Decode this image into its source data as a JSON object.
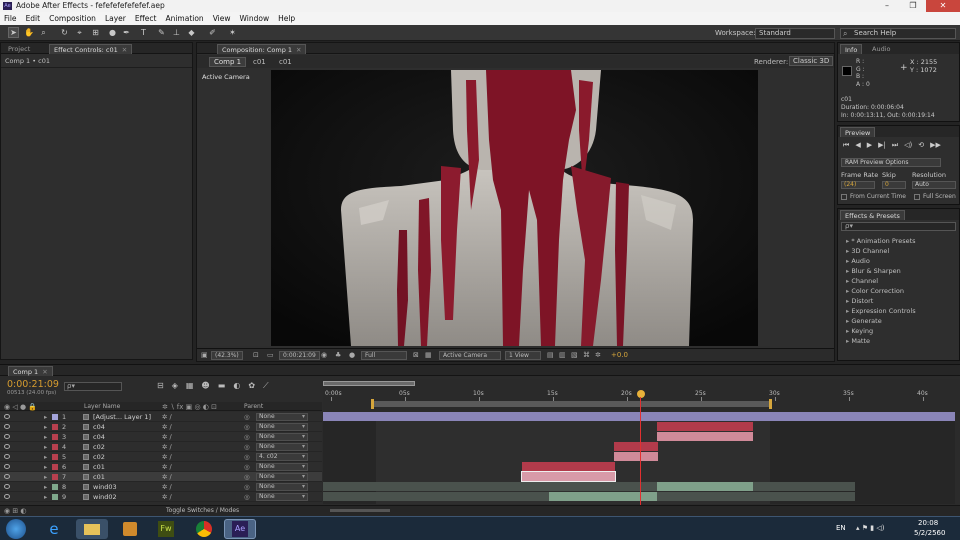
{
  "window": {
    "title": "Adobe After Effects - fefefefefefefef.aep",
    "app_icon": "Ae"
  },
  "menu": [
    "File",
    "Edit",
    "Composition",
    "Layer",
    "Effect",
    "Animation",
    "View",
    "Window",
    "Help"
  ],
  "workspace": {
    "label": "Workspace:",
    "value": "Standard"
  },
  "search_help": "Search Help",
  "left_panel": {
    "tab_project": "Project",
    "tab_effect_controls": "Effect Controls: c01",
    "breadcrumb": "Comp 1 • c01"
  },
  "comp_panel": {
    "tab": "Composition: Comp 1",
    "crumb_comp": "Comp 1",
    "crumb_c01a": "c01",
    "crumb_c01b": "c01",
    "renderer_label": "Renderer:",
    "renderer_value": "Classic 3D",
    "camera": "Active Camera"
  },
  "viewer_bar": {
    "zoom": "(42.3%)",
    "time": "0:00:21:09",
    "quality": "Full",
    "camera": "Active Camera",
    "view": "1 View",
    "exposure": "+0.0"
  },
  "info": {
    "tab_info": "Info",
    "tab_audio": "Audio",
    "r": "R :",
    "g": "G :",
    "b": "B :",
    "a": "A : 0",
    "x": "X : 2155",
    "y": "Y : 1072",
    "layer": "c01",
    "duration": "Duration: 0:00:06:04",
    "inout": "In: 0:00:13:11, Out: 0:00:19:14"
  },
  "preview": {
    "tab": "Preview",
    "ram": "RAM Preview Options",
    "frame_rate_label": "Frame Rate",
    "skip_label": "Skip",
    "resolution_label": "Resolution",
    "frame_rate": "(24)",
    "skip": "0",
    "resolution": "Auto",
    "from_current": "From Current Time",
    "full_screen": "Full Screen"
  },
  "effects": {
    "tab": "Effects & Presets",
    "items": [
      "* Animation Presets",
      "3D Channel",
      "Audio",
      "Blur & Sharpen",
      "Channel",
      "Color Correction",
      "Distort",
      "Expression Controls",
      "Generate",
      "Keying",
      "Matte"
    ]
  },
  "timeline": {
    "tab": "Comp 1",
    "timecode": "0:00:21:09",
    "fps": "00513 (24.00 fps)",
    "search": "ρ▾",
    "col_layer": "Layer Name",
    "col_parent": "Parent",
    "toggle": "Toggle Switches / Modes",
    "ruler": [
      "0:00s",
      "05s",
      "10s",
      "15s",
      "20s",
      "25s",
      "30s",
      "35s",
      "40s"
    ],
    "layers": [
      {
        "num": "1",
        "name": "[Adjust... Layer 1]",
        "color": "#a3a3d9",
        "parent": "None"
      },
      {
        "num": "2",
        "name": "c04",
        "color": "#b8404f",
        "parent": "None"
      },
      {
        "num": "3",
        "name": "c04",
        "color": "#b8404f",
        "parent": "None"
      },
      {
        "num": "4",
        "name": "c02",
        "color": "#b8404f",
        "parent": "None"
      },
      {
        "num": "5",
        "name": "c02",
        "color": "#b8404f",
        "parent": "4. c02"
      },
      {
        "num": "6",
        "name": "c01",
        "color": "#b8404f",
        "parent": "None"
      },
      {
        "num": "7",
        "name": "c01",
        "color": "#b8404f",
        "parent": "None"
      },
      {
        "num": "8",
        "name": "wind03",
        "color": "#7fa88c",
        "parent": "None"
      },
      {
        "num": "9",
        "name": "wind02",
        "color": "#7fa88c",
        "parent": "None"
      }
    ]
  },
  "tray": {
    "lang": "EN",
    "time": "20:08",
    "date": "5/2/2560"
  }
}
